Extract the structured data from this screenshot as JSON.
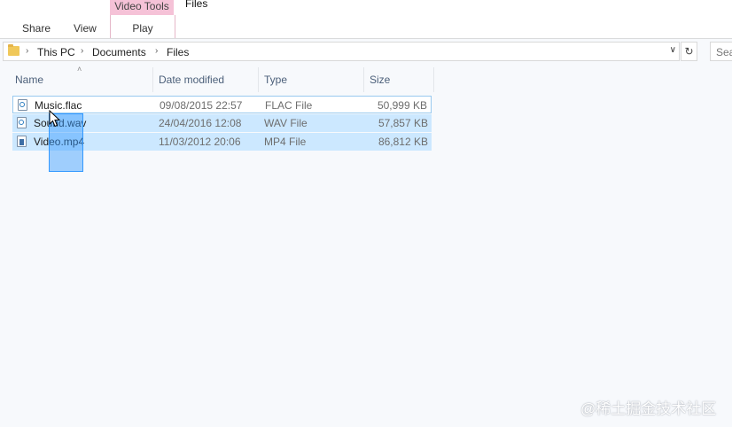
{
  "ribbon": {
    "tabs": [
      "Share",
      "View"
    ],
    "context_group": "Video Tools",
    "context_tab": "Play",
    "window_title": "Files"
  },
  "address": {
    "crumbs": [
      "This PC",
      "Documents",
      "Files"
    ],
    "search_placeholder": "Sea"
  },
  "columns": [
    "Name",
    "Date modified",
    "Type",
    "Size"
  ],
  "files": [
    {
      "name": "Music.flac",
      "date": "09/08/2015 22:57",
      "type": "FLAC File",
      "size": "50,999 KB",
      "icon": "audio-file-icon",
      "selected": false
    },
    {
      "name": "Sound.wav",
      "date": "24/04/2016 12:08",
      "type": "WAV File",
      "size": "57,857 KB",
      "icon": "audio-file-icon",
      "selected": true
    },
    {
      "name": "Video.mp4",
      "date": "11/03/2012 20:06",
      "type": "MP4 File",
      "size": "86,812 KB",
      "icon": "video-file-icon",
      "selected": true
    }
  ],
  "watermark": "@稀土掘金技术社区",
  "colors": {
    "selection": "#cce8ff",
    "context_tab": "#f5c2d7",
    "lasso": "#3399ff"
  }
}
